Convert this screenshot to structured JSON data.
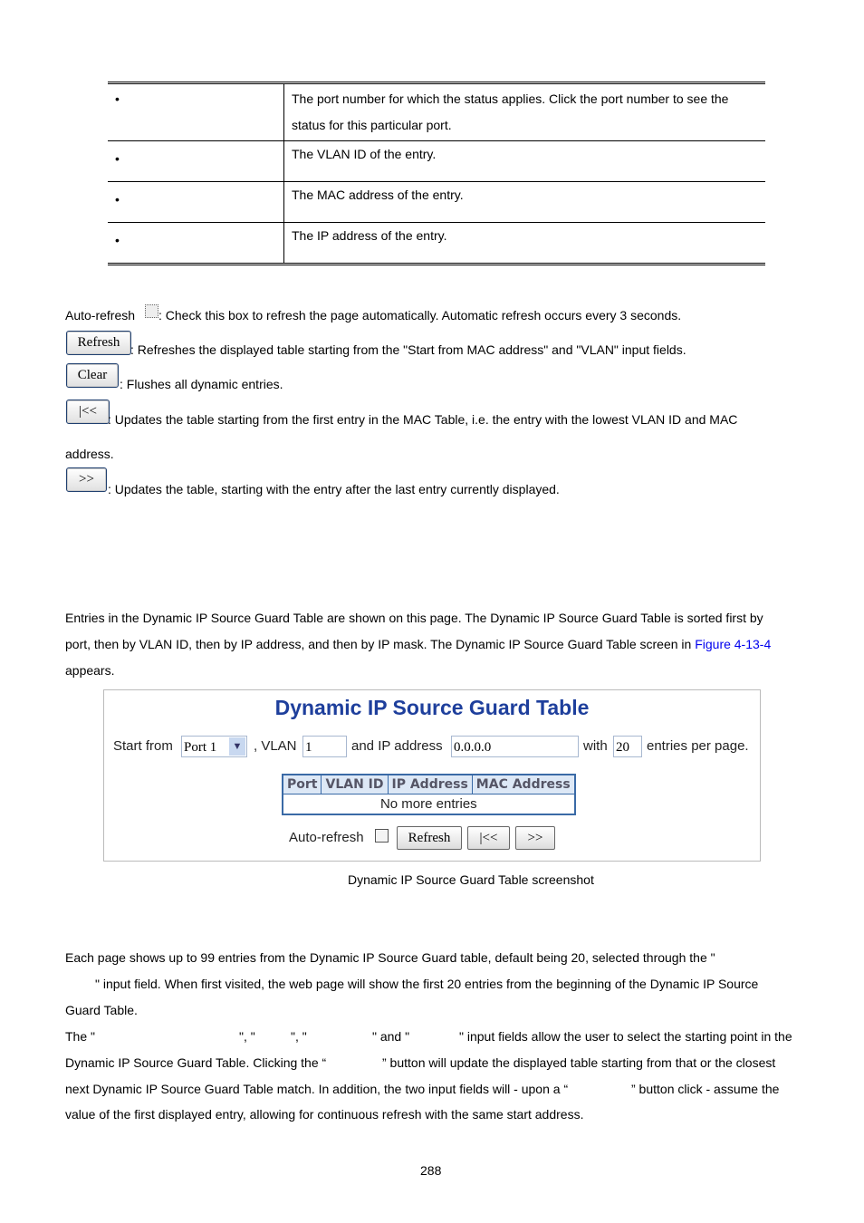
{
  "desc_table": {
    "rows": [
      {
        "bullet": "•",
        "text": "The port number for which the status applies. Click the port number to see the status for this particular port."
      },
      {
        "bullet": "•",
        "text": "The VLAN ID of the entry."
      },
      {
        "bullet": "•",
        "text": "The MAC address of the entry."
      },
      {
        "bullet": "•",
        "text": "The IP address of the entry."
      }
    ]
  },
  "buttons_desc": {
    "auto_refresh_label": "Auto-refresh",
    "auto_refresh_text": ": Check this box to refresh the page automatically. Automatic refresh occurs every 3 seconds.",
    "refresh_label": "Refresh",
    "refresh_text": ": Refreshes the displayed table starting from the \"Start from MAC address\" and \"VLAN\" input fields.",
    "clear_label": "Clear",
    "clear_text": ": Flushes all dynamic entries.",
    "first_label": "|<<",
    "first_text": ": Updates the table starting from the first entry in the MAC Table, i.e. the entry with the lowest VLAN ID and MAC",
    "first_text2": "address.",
    "next_label": ">>",
    "next_text": ": Updates the table, starting with the entry after the last entry currently displayed."
  },
  "intro": {
    "line1": "Entries in the Dynamic IP Source Guard Table are shown on this page. The Dynamic IP Source Guard Table is sorted first by",
    "line2": "port, then by VLAN ID, then by IP address, and then by IP mask. The Dynamic IP Source Guard Table screen in ",
    "link": "Figure 4-13-4",
    "line3": "appears."
  },
  "screenshot": {
    "title": "Dynamic IP Source Guard Table",
    "start_from": "Start from",
    "port_value": "Port 1",
    "vlan_label": ", VLAN",
    "vlan_value": "1",
    "ip_label": "and IP address",
    "ip_value": "0.0.0.0",
    "with_label": "with",
    "entries_value": "20",
    "entries_label": "entries per page.",
    "columns": [
      "Port",
      "VLAN ID",
      "IP Address",
      "MAC Address"
    ],
    "empty": "No more entries",
    "auto_refresh": "Auto-refresh",
    "refresh": "Refresh",
    "first": "|<<",
    "next": ">>"
  },
  "caption": "Dynamic IP Source Guard Table screenshot",
  "body": {
    "l1": "Each page shows up to 99 entries from the Dynamic IP Source Guard table, default being 20, selected through the \"",
    "l2": "\" input field. When first visited, the web page will show the first 20 entries from the beginning of the Dynamic IP Source",
    "l3": "Guard Table.",
    "l4a": "The \"",
    "l4b": "\", \"",
    "l4c": "\", \"",
    "l4d": "\" and \"",
    "l4e": "\" input fields allow the user to select the starting point in the",
    "l5a": "Dynamic IP Source Guard Table. Clicking the “",
    "l5b": "” button will update the displayed table starting from that or the closest",
    "l6a": "next Dynamic IP Source Guard Table match. In addition, the two input fields will - upon a “",
    "l6b": "” button click - assume the",
    "l7": "value of the first displayed entry, allowing for continuous refresh with the same start address."
  },
  "page_number": "288"
}
